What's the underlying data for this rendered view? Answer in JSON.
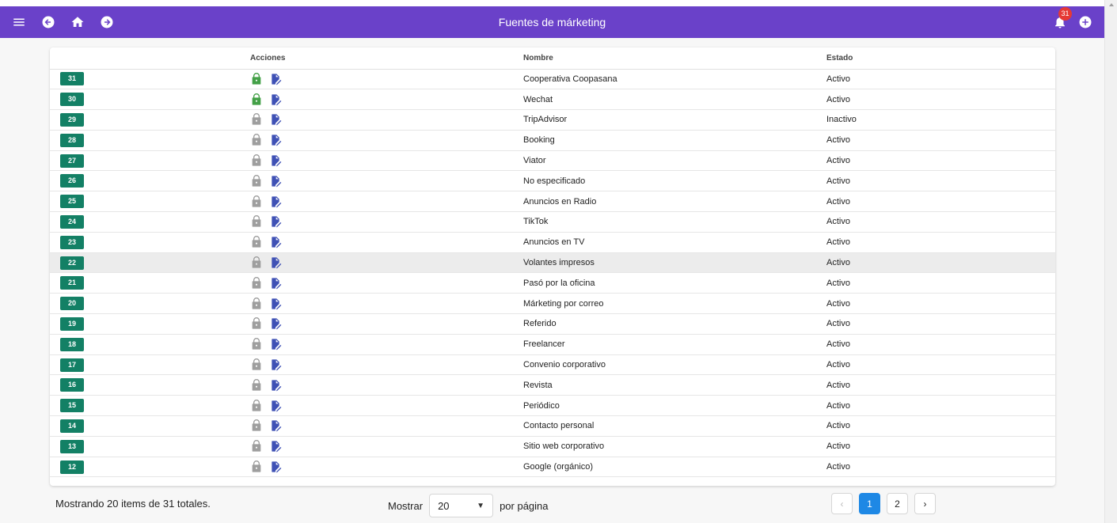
{
  "header": {
    "title": "Fuentes de márketing",
    "notification_count": "31",
    "icons": [
      "menu-icon",
      "back-icon",
      "home-icon",
      "forward-icon",
      "bell-icon",
      "add-circle-icon"
    ],
    "color": "#6a41c9"
  },
  "table": {
    "columns": {
      "id": "",
      "actions": "Acciones",
      "name": "Nombre",
      "status": "Estado"
    },
    "rows": [
      {
        "id": "31",
        "name": "Cooperativa Coopasana",
        "status": "Activo",
        "lock": "green"
      },
      {
        "id": "30",
        "name": "Wechat",
        "status": "Activo",
        "lock": "green"
      },
      {
        "id": "29",
        "name": "TripAdvisor",
        "status": "Inactivo",
        "lock": "grey"
      },
      {
        "id": "28",
        "name": "Booking",
        "status": "Activo",
        "lock": "grey"
      },
      {
        "id": "27",
        "name": "Viator",
        "status": "Activo",
        "lock": "grey"
      },
      {
        "id": "26",
        "name": "No especificado",
        "status": "Activo",
        "lock": "grey"
      },
      {
        "id": "25",
        "name": "Anuncios en Radio",
        "status": "Activo",
        "lock": "grey"
      },
      {
        "id": "24",
        "name": "TikTok",
        "status": "Activo",
        "lock": "grey"
      },
      {
        "id": "23",
        "name": "Anuncios en TV",
        "status": "Activo",
        "lock": "grey"
      },
      {
        "id": "22",
        "name": "Volantes impresos",
        "status": "Activo",
        "lock": "grey",
        "highlighted": true
      },
      {
        "id": "21",
        "name": "Pasó por la oficina",
        "status": "Activo",
        "lock": "grey"
      },
      {
        "id": "20",
        "name": "Márketing por correo",
        "status": "Activo",
        "lock": "grey"
      },
      {
        "id": "19",
        "name": "Referido",
        "status": "Activo",
        "lock": "grey"
      },
      {
        "id": "18",
        "name": "Freelancer",
        "status": "Activo",
        "lock": "grey"
      },
      {
        "id": "17",
        "name": "Convenio corporativo",
        "status": "Activo",
        "lock": "grey"
      },
      {
        "id": "16",
        "name": "Revista",
        "status": "Activo",
        "lock": "grey"
      },
      {
        "id": "15",
        "name": "Periódico",
        "status": "Activo",
        "lock": "grey"
      },
      {
        "id": "14",
        "name": "Contacto personal",
        "status": "Activo",
        "lock": "grey"
      },
      {
        "id": "13",
        "name": "Sitio web corporativo",
        "status": "Activo",
        "lock": "grey"
      },
      {
        "id": "12",
        "name": "Google (orgánico)",
        "status": "Activo",
        "lock": "grey"
      }
    ]
  },
  "footer": {
    "count_text": "Mostrando 20 items de 31 totales.",
    "show_label": "Mostrar",
    "page_size": "20",
    "per_page_label": "por página",
    "pages": [
      "1",
      "2"
    ],
    "current_page": "1",
    "prev": "‹",
    "next": "›"
  },
  "colors": {
    "id_badge": "#138065",
    "lock_active": "#43a047",
    "lock_inactive": "#9e9e9e",
    "edit": "#3f51b5",
    "page_active": "#1e88e5"
  }
}
